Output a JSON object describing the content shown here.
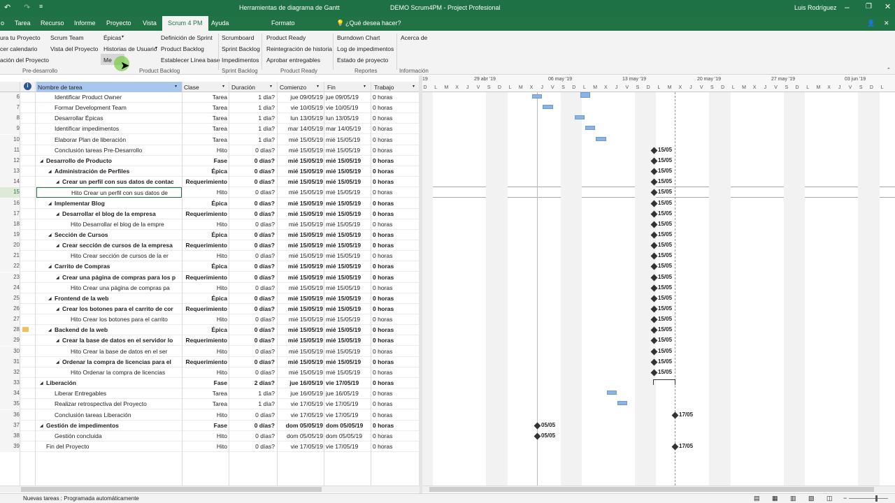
{
  "titlebar": {
    "context": "Herramientas de diagrama de Gantt",
    "title": "DEMO Scrum4PM  -  Project Profesional",
    "user": "Luis Rodríguez",
    "undo_icon": "undo-icon",
    "redo_icon": "redo-icon"
  },
  "tabs": [
    {
      "label": "o"
    },
    {
      "label": "Tarea"
    },
    {
      "label": "Recurso"
    },
    {
      "label": "Informe"
    },
    {
      "label": "Proyecto"
    },
    {
      "label": "Vista"
    },
    {
      "label": "Scrum 4 PM"
    },
    {
      "label": "Ayuda"
    },
    {
      "label": "Formato"
    },
    {
      "label": "¿Qué desea hacer?"
    }
  ],
  "ribbon": {
    "btn1": "ura tu Proyecto",
    "btn2": "cer calendario",
    "btn3": "ación del Proyecto",
    "btn4": "Scrum Team",
    "btn5": "Vista del Proyecto",
    "btn6": "Épicas",
    "btn7": "Historias de Usuario",
    "btn8": "Me",
    "btn9": "Definición de Sprint",
    "btn10": "Product Backlog",
    "btn11": "Establecer Línea base",
    "btn12": "Scrumboard",
    "btn13": "Sprint Backlog",
    "btn14": "Impedimentos",
    "btn15": "Product Ready",
    "btn16": "Reintegración de historia",
    "btn17": "Aprobar entregables",
    "btn18": "Burndown Chart",
    "btn19": "Log de impedimentos",
    "btn20": "Estado de proyecto",
    "btn21": "Acerca de",
    "g1": "Pre-desarrollo",
    "g2": "Product Backlog",
    "g3": "Sprint Backlog",
    "g4": "Product Ready",
    "g5": "Reportes",
    "g6": "Información"
  },
  "grid": {
    "headers": {
      "info": "i",
      "name": "Nombre de tarea",
      "clase": "Clase",
      "dur": "Duración",
      "start": "Comienzo",
      "end": "Fin",
      "work": "Trabajo"
    },
    "rows": [
      {
        "n": "6",
        "name": "Identificar Product Owner",
        "clase": "Tarea",
        "dur": "1 día?",
        "start": "jue 09/05/19",
        "end": "jue 09/05/19",
        "work": "0 horas",
        "lvl": 2,
        "bold": false
      },
      {
        "n": "7",
        "name": "Formar Development Team",
        "clase": "Tarea",
        "dur": "1 día?",
        "start": "vie 10/05/19",
        "end": "vie 10/05/19",
        "work": "0 horas",
        "lvl": 2,
        "bold": false
      },
      {
        "n": "8",
        "name": "Desarrollar Épicas",
        "clase": "Tarea",
        "dur": "1 día?",
        "start": "lun 13/05/19",
        "end": "lun 13/05/19",
        "work": "0 horas",
        "lvl": 2,
        "bold": false
      },
      {
        "n": "9",
        "name": "Identificar impedimentos",
        "clase": "Tarea",
        "dur": "1 día?",
        "start": "mar 14/05/19",
        "end": "mar 14/05/19",
        "work": "0 horas",
        "lvl": 2,
        "bold": false
      },
      {
        "n": "10",
        "name": "Elaborar Plan de liberación",
        "clase": "Tarea",
        "dur": "1 día?",
        "start": "mié 15/05/19",
        "end": "mié 15/05/19",
        "work": "0 horas",
        "lvl": 2,
        "bold": false
      },
      {
        "n": "11",
        "name": "Conclusión tareas Pre-Desarrollo",
        "clase": "Hito",
        "dur": "0 días?",
        "start": "mié 15/05/19",
        "end": "mié 15/05/19",
        "work": "0 horas",
        "lvl": 2,
        "bold": false
      },
      {
        "n": "12",
        "name": "Desarrollo de Producto",
        "clase": "Fase",
        "dur": "0 días?",
        "start": "mié 15/05/19",
        "end": "mié 15/05/19",
        "work": "0 horas",
        "lvl": 1,
        "bold": true
      },
      {
        "n": "13",
        "name": "Administración de Perfiles",
        "clase": "Épica",
        "dur": "0 días?",
        "start": "mié 15/05/19",
        "end": "mié 15/05/19",
        "work": "0 horas",
        "lvl": 2,
        "bold": true
      },
      {
        "n": "14",
        "name": "Crear un perfil con sus datos de contac",
        "clase": "Requerimiento",
        "dur": "0 días?",
        "start": "mié 15/05/19",
        "end": "mié 15/05/19",
        "work": "0 horas",
        "lvl": 3,
        "bold": true
      },
      {
        "n": "15",
        "name": "Hito Crear un perfil con sus datos de",
        "clase": "Hito",
        "dur": "0 días?",
        "start": "mié 15/05/19",
        "end": "mié 15/05/19",
        "work": "0 horas",
        "lvl": 4,
        "bold": false
      },
      {
        "n": "16",
        "name": "Implementar Blog",
        "clase": "Épica",
        "dur": "0 días?",
        "start": "mié 15/05/19",
        "end": "mié 15/05/19",
        "work": "0 horas",
        "lvl": 2,
        "bold": true
      },
      {
        "n": "17",
        "name": "Desarrollar el blog de la empresa",
        "clase": "Requerimiento",
        "dur": "0 días?",
        "start": "mié 15/05/19",
        "end": "mié 15/05/19",
        "work": "0 horas",
        "lvl": 3,
        "bold": true
      },
      {
        "n": "18",
        "name": "Hito Desarrollar el blog de la empre",
        "clase": "Hito",
        "dur": "0 días?",
        "start": "mié 15/05/19",
        "end": "mié 15/05/19",
        "work": "0 horas",
        "lvl": 4,
        "bold": false
      },
      {
        "n": "19",
        "name": "Sección de Cursos",
        "clase": "Épica",
        "dur": "0 días?",
        "start": "mié 15/05/19",
        "end": "mié 15/05/19",
        "work": "0 horas",
        "lvl": 2,
        "bold": true
      },
      {
        "n": "20",
        "name": "Crear sección de cursos de la empresa",
        "clase": "Requerimiento",
        "dur": "0 días?",
        "start": "mié 15/05/19",
        "end": "mié 15/05/19",
        "work": "0 horas",
        "lvl": 3,
        "bold": true
      },
      {
        "n": "21",
        "name": "Hito Crear sección de cursos de la er",
        "clase": "Hito",
        "dur": "0 días?",
        "start": "mié 15/05/19",
        "end": "mié 15/05/19",
        "work": "0 horas",
        "lvl": 4,
        "bold": false
      },
      {
        "n": "22",
        "name": "Carrito de Compras",
        "clase": "Épica",
        "dur": "0 días?",
        "start": "mié 15/05/19",
        "end": "mié 15/05/19",
        "work": "0 horas",
        "lvl": 2,
        "bold": true
      },
      {
        "n": "23",
        "name": "Crear una página de compras para los p",
        "clase": "Requerimiento",
        "dur": "0 días?",
        "start": "mié 15/05/19",
        "end": "mié 15/05/19",
        "work": "0 horas",
        "lvl": 3,
        "bold": true
      },
      {
        "n": "24",
        "name": "Hito Crear una página de compras pa",
        "clase": "Hito",
        "dur": "0 días?",
        "start": "mié 15/05/19",
        "end": "mié 15/05/19",
        "work": "0 horas",
        "lvl": 4,
        "bold": false
      },
      {
        "n": "25",
        "name": "Frontend de la web",
        "clase": "Épica",
        "dur": "0 días?",
        "start": "mié 15/05/19",
        "end": "mié 15/05/19",
        "work": "0 horas",
        "lvl": 2,
        "bold": true
      },
      {
        "n": "26",
        "name": "Crear los botones para el carrito de cor",
        "clase": "Requerimiento",
        "dur": "0 días?",
        "start": "mié 15/05/19",
        "end": "mié 15/05/19",
        "work": "0 horas",
        "lvl": 3,
        "bold": true
      },
      {
        "n": "27",
        "name": "Hito Crear los botones para el carrito",
        "clase": "Hito",
        "dur": "0 días?",
        "start": "mié 15/05/19",
        "end": "mié 15/05/19",
        "work": "0 horas",
        "lvl": 4,
        "bold": false
      },
      {
        "n": "28",
        "name": "Backend de la web",
        "clase": "Épica",
        "dur": "0 días?",
        "start": "mié 15/05/19",
        "end": "mié 15/05/19",
        "work": "0 horas",
        "lvl": 2,
        "bold": true
      },
      {
        "n": "29",
        "name": "Crear la base de datos en el servidor lo",
        "clase": "Requerimiento",
        "dur": "0 días?",
        "start": "mié 15/05/19",
        "end": "mié 15/05/19",
        "work": "0 horas",
        "lvl": 3,
        "bold": true
      },
      {
        "n": "30",
        "name": "Hito Crear la base de datos en el ser",
        "clase": "Hito",
        "dur": "0 días?",
        "start": "mié 15/05/19",
        "end": "mié 15/05/19",
        "work": "0 horas",
        "lvl": 4,
        "bold": false
      },
      {
        "n": "31",
        "name": "Ordenar la compra de licencias para el",
        "clase": "Requerimiento",
        "dur": "0 días?",
        "start": "mié 15/05/19",
        "end": "mié 15/05/19",
        "work": "0 horas",
        "lvl": 3,
        "bold": true
      },
      {
        "n": "32",
        "name": "Hito Ordenar la compra de licencias",
        "clase": "Hito",
        "dur": "0 días?",
        "start": "mié 15/05/19",
        "end": "mié 15/05/19",
        "work": "0 horas",
        "lvl": 4,
        "bold": false
      },
      {
        "n": "33",
        "name": "Liberación",
        "clase": "Fase",
        "dur": "2 días?",
        "start": "jue 16/05/19",
        "end": "vie 17/05/19",
        "work": "0 horas",
        "lvl": 1,
        "bold": true
      },
      {
        "n": "34",
        "name": "Liberar Entregables",
        "clase": "Tarea",
        "dur": "1 día?",
        "start": "jue 16/05/19",
        "end": "jue 16/05/19",
        "work": "0 horas",
        "lvl": 2,
        "bold": false
      },
      {
        "n": "35",
        "name": "Realizar retrospectiva del Proyecto",
        "clase": "Tarea",
        "dur": "1 día?",
        "start": "vie 17/05/19",
        "end": "vie 17/05/19",
        "work": "0 horas",
        "lvl": 2,
        "bold": false
      },
      {
        "n": "36",
        "name": "Conclusión tareas Liberación",
        "clase": "Hito",
        "dur": "0 días?",
        "start": "vie 17/05/19",
        "end": "vie 17/05/19",
        "work": "0 horas",
        "lvl": 2,
        "bold": false
      },
      {
        "n": "37",
        "name": "Gestión de impedimentos",
        "clase": "Fase",
        "dur": "0 días?",
        "start": "dom 05/05/19",
        "end": "dom 05/05/19",
        "work": "0 horas",
        "lvl": 1,
        "bold": true
      },
      {
        "n": "38",
        "name": "Gestión concluida",
        "clase": "Hito",
        "dur": "0 días?",
        "start": "dom 05/05/19",
        "end": "dom 05/05/19",
        "work": "0 horas",
        "lvl": 2,
        "bold": false
      },
      {
        "n": "39",
        "name": "Fin del Proyecto",
        "clase": "Hito",
        "dur": "0 días?",
        "start": "vie 17/05/19",
        "end": "vie 17/05/19",
        "work": "0 horas",
        "lvl": 1,
        "bold": false
      }
    ]
  },
  "timescale": {
    "weeks": [
      "19",
      "29 abr '19",
      "06 may '19",
      "13 may '19",
      "20 may '19",
      "27 may '19",
      "03 jun '19"
    ],
    "days": [
      "L",
      "M",
      "X",
      "J",
      "V",
      "S",
      "D"
    ]
  },
  "gantt": {
    "milestone_label": "15/05",
    "end_label": "17/05",
    "imp_label": "05/05"
  },
  "status": {
    "text": "Nuevas tareas : Programada automáticamente"
  }
}
